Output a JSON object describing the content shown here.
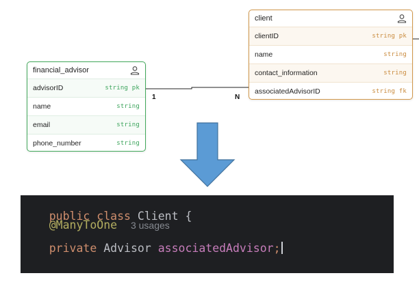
{
  "diagram": {
    "financial_advisor": {
      "title": "financial_advisor",
      "fields": [
        {
          "name": "advisorID",
          "type": "string pk"
        },
        {
          "name": "name",
          "type": "string"
        },
        {
          "name": "email",
          "type": "string"
        },
        {
          "name": "phone_number",
          "type": "string"
        }
      ]
    },
    "client": {
      "title": "client",
      "fields": [
        {
          "name": "clientID",
          "type": "string pk"
        },
        {
          "name": "name",
          "type": "string"
        },
        {
          "name": "contact_information",
          "type": "string"
        },
        {
          "name": "associatedAdvisorID",
          "type": "string fk"
        }
      ]
    },
    "relationship": {
      "from_cardinality": "1",
      "to_cardinality": "N"
    },
    "colors": {
      "advisor_border": "#41a85a",
      "client_border": "#d1974a",
      "arrow": "#4a86c8",
      "code_bg": "#1e1f22"
    }
  },
  "code": {
    "line1": {
      "kw1": "public",
      "kw2": "class",
      "name": "Client",
      "brace": "{"
    },
    "line2": {
      "annotation": "@ManyToOne",
      "usages": "3 usages"
    },
    "line3": {
      "kw": "private",
      "type": "Advisor",
      "field": "associatedAdvisor",
      "semi": ";"
    }
  }
}
